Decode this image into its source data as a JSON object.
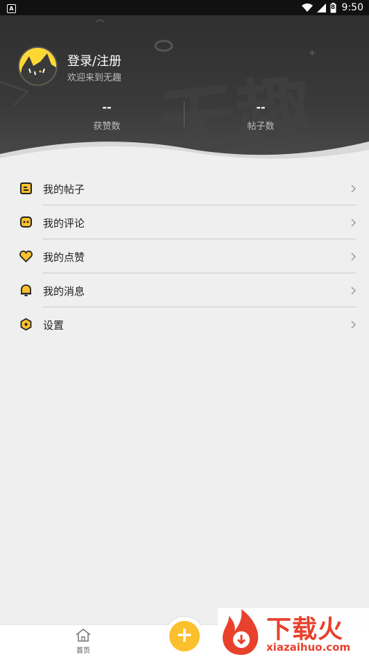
{
  "status_bar": {
    "app_icon": "A",
    "time": "9:50",
    "battery_level": "8"
  },
  "user": {
    "title": "登录/注册",
    "subtitle": "欢迎来到无趣"
  },
  "stats": [
    {
      "value": "--",
      "label": "获赞数"
    },
    {
      "value": "--",
      "label": "帖子数"
    }
  ],
  "header_decor_text": "无趣",
  "menu": [
    {
      "label": "我的帖子",
      "icon": "post-icon"
    },
    {
      "label": "我的评论",
      "icon": "comment-icon"
    },
    {
      "label": "我的点赞",
      "icon": "heart-icon"
    },
    {
      "label": "我的消息",
      "icon": "bell-icon"
    },
    {
      "label": "设置",
      "icon": "settings-icon"
    }
  ],
  "bottom_nav": {
    "home_label": "首页",
    "fab_symbol": "+"
  },
  "watermark": {
    "text": "下载火",
    "url": "xiazaihuo.com"
  },
  "colors": {
    "accent": "#fbc02d",
    "header_bg": "#333333",
    "watermark": "#e8412c"
  }
}
